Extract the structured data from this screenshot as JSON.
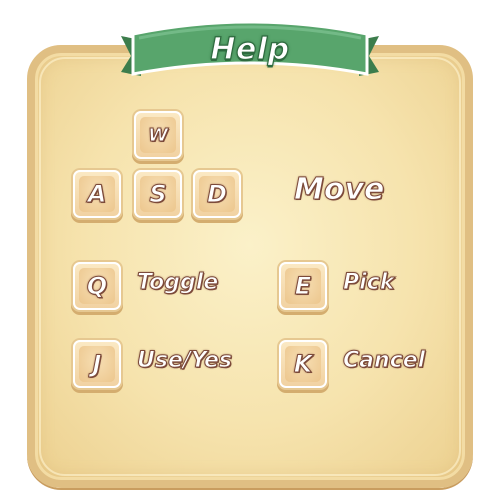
{
  "title": "Help",
  "keys": {
    "w": "W",
    "a": "A",
    "s": "S",
    "d": "D",
    "q": "Q",
    "e": "E",
    "j": "J",
    "k": "K"
  },
  "actions": {
    "move": "Move",
    "toggle": "Toggle",
    "pick": "Pick",
    "use_yes": "Use/Yes",
    "cancel": "Cancel"
  },
  "colors": {
    "ribbon": "#4f9a62",
    "ribbon_dark": "#2e6b3f",
    "parchment": "#f6e3ad",
    "parchment_border": "#e0bf83",
    "text_outline": "#7c4a3a",
    "key_face": "#f1d2a2"
  }
}
